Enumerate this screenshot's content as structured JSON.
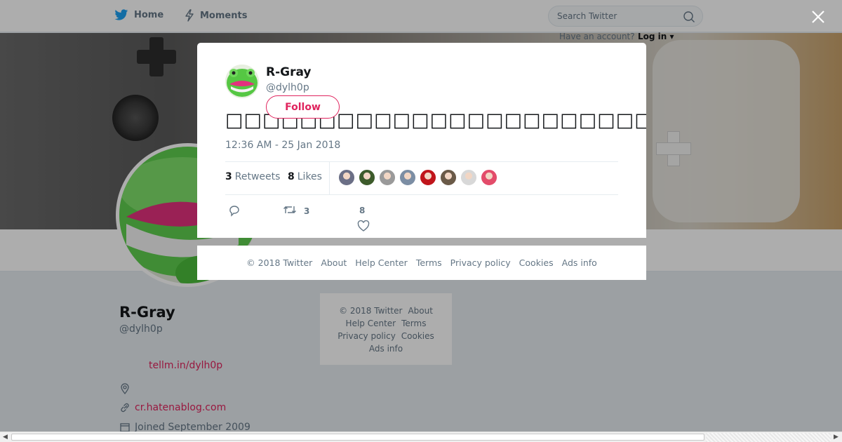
{
  "topbar": {
    "home_label": "Home",
    "moments_label": "Moments",
    "search_placeholder": "Search Twitter",
    "have_account": "Have an account?",
    "login_label": "Log in"
  },
  "profile": {
    "name": "R-Gray",
    "handle": "@dylh0p",
    "bio_link": "tellm.in/dylh0p",
    "website": "cr.hatenablog.com",
    "joined": "Joined September 2009"
  },
  "side_footer": {
    "line1": [
      "© 2018 Twitter",
      "About"
    ],
    "line2": [
      "Help Center",
      "Terms"
    ],
    "line3": [
      "Privacy policy",
      "Cookies"
    ],
    "line4": [
      "Ads info"
    ]
  },
  "modal": {
    "name": "R-Gray",
    "handle": "@dylh0p",
    "follow_label": "Follow",
    "tweet_text": "□□□□□□□□□□□□□□□□□□□□□□□□□□□□□□□□□□□□□□□□□□□□□□□□",
    "timestamp": "12:36 AM - 25 Jan 2018",
    "retweets_count": "3",
    "retweets_label": "Retweets",
    "likes_count": "8",
    "likes_label": "Likes",
    "liker_colors": [
      "#6b6f86",
      "#3d5b2b",
      "#9a9a9a",
      "#7c8ea4",
      "#c0151b",
      "#6a5a48",
      "#d8d8d8",
      "#e34c6a"
    ],
    "action_retweet_count": "3",
    "action_like_count": "8"
  },
  "footer": {
    "links": [
      "© 2018 Twitter",
      "About",
      "Help Center",
      "Terms",
      "Privacy policy",
      "Cookies",
      "Ads info"
    ]
  },
  "colors": {
    "accent": "#e0245e",
    "text_muted": "#657786",
    "twitter_blue": "#1da1f2"
  },
  "icons": [
    "twitter-bird-icon",
    "lightning-icon",
    "search-icon",
    "close-icon",
    "location-icon",
    "link-icon",
    "calendar-icon",
    "reply-icon",
    "retweet-icon",
    "heart-icon"
  ]
}
